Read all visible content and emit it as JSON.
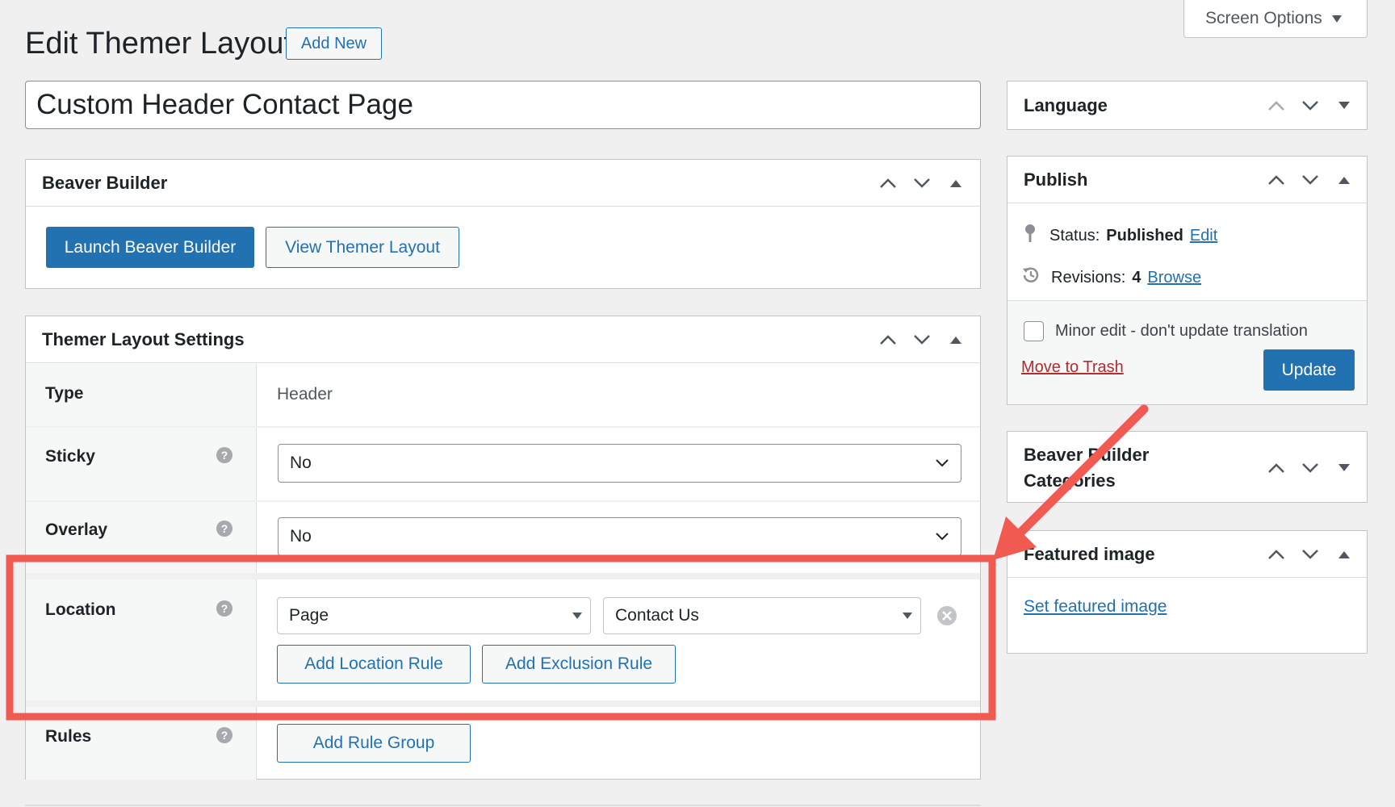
{
  "header": {
    "title": "Edit Themer Layout",
    "add_new_label": "Add New",
    "screen_options_label": "Screen Options",
    "post_title": "Custom Header Contact Page"
  },
  "beaver_builder_box": {
    "title": "Beaver Builder",
    "launch_label": "Launch Beaver Builder",
    "view_label": "View Themer Layout"
  },
  "settings_box": {
    "title": "Themer Layout Settings",
    "type_label": "Type",
    "type_value": "Header",
    "sticky_label": "Sticky",
    "sticky_value": "No",
    "overlay_label": "Overlay",
    "overlay_value": "No",
    "location_label": "Location",
    "location_type_value": "Page",
    "location_page_value": "Contact Us",
    "add_location_rule_label": "Add Location Rule",
    "add_exclusion_rule_label": "Add Exclusion Rule",
    "rules_label": "Rules",
    "add_rule_group_label": "Add Rule Group",
    "help_glyph": "?"
  },
  "sidebar": {
    "language": {
      "title": "Language"
    },
    "publish": {
      "title": "Publish",
      "status_prefix": "Status:",
      "status_value": "Published",
      "status_edit_link": "Edit",
      "revisions_prefix": "Revisions:",
      "revisions_count": "4",
      "revisions_browse_link": "Browse",
      "minor_edit_label": "Minor edit - don't update translation",
      "minor_edit_checked": false,
      "trash_label": "Move to Trash",
      "update_label": "Update"
    },
    "bb_categories": {
      "title_line1": "Beaver Builder",
      "title_line2": "Categories"
    },
    "featured_image": {
      "title": "Featured image",
      "set_link": "Set featured image"
    }
  },
  "annotation": {
    "highlight_color": "#f05a50",
    "arrow_color": "#f05a50"
  },
  "colors": {
    "accent": "#2271b1",
    "trash": "#b32d2e",
    "background": "#f0f0f1"
  }
}
